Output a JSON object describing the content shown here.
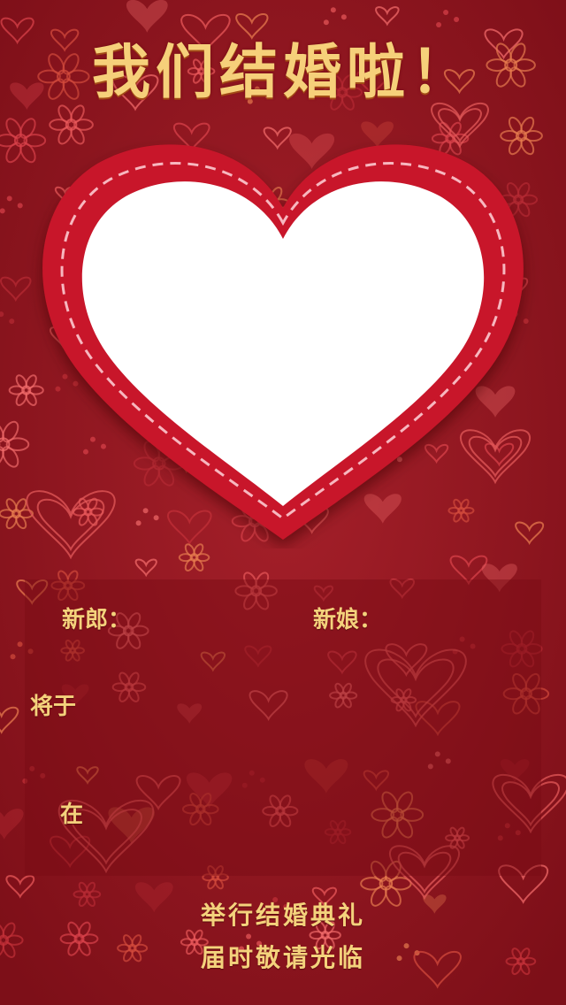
{
  "header": {
    "title": "我们结婚啦！"
  },
  "form": {
    "groom_label": "新郎：",
    "bride_label": "新娘：",
    "date_label": "将于",
    "place_label": "在"
  },
  "footer": {
    "line1": "举行结婚典礼",
    "line2": "届时敬请光临"
  },
  "colors": {
    "background": "#9c1a22",
    "accent_gold": "#f4d27c",
    "heart_frame": "#c8162a",
    "photo_area": "#ffffff"
  }
}
